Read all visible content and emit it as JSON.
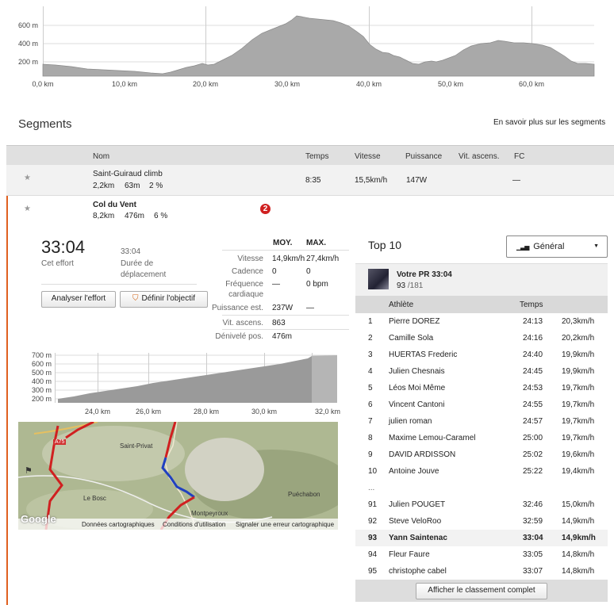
{
  "main_chart": {
    "y_ticks": [
      "600 m",
      "400 m",
      "200 m"
    ],
    "x_ticks": [
      "0,0 km",
      "10,0 km",
      "20,0 km",
      "30,0 km",
      "40,0 km",
      "50,0 km",
      "60,0 km"
    ]
  },
  "segments": {
    "title": "Segments",
    "learn_more": "En savoir plus sur les segments",
    "columns": {
      "name": "Nom",
      "time": "Temps",
      "speed": "Vitesse",
      "power": "Puissance",
      "vam": "Vit. ascens.",
      "hr": "FC"
    },
    "rows": [
      {
        "name": "Saint-Guiraud climb",
        "distance": "2,2km",
        "elevation": "63m",
        "grade": "2 %",
        "time": "8:35",
        "speed": "15,5km/h",
        "power": "147W",
        "hr": "—"
      },
      {
        "name": "Col du Vent",
        "distance": "8,2km",
        "elevation": "476m",
        "grade": "6 %",
        "badge": "2"
      }
    ]
  },
  "effort": {
    "time": "33:04",
    "time_label": "Cet effort",
    "moving_time": "33:04",
    "moving_label": "Durée de déplacement",
    "analyze_button": "Analyser l'effort",
    "goal_button": "Définir l'objectif",
    "stats_head": {
      "avg": "MOY.",
      "max": "MAX."
    },
    "stats": [
      {
        "label": "Vitesse",
        "avg": "14,9km/h",
        "max": "27,4km/h"
      },
      {
        "label": "Cadence",
        "avg": "0",
        "max": "0"
      },
      {
        "label": "Fréquence cardiaque",
        "avg": "—",
        "max": "0 bpm"
      },
      {
        "label": "Puissance est.",
        "avg": "237W",
        "max": "—"
      },
      {
        "label": "Vit. ascens.",
        "avg": "863",
        "max": ""
      },
      {
        "label": "Dénivelé pos.",
        "avg": "476m",
        "max": ""
      }
    ]
  },
  "mini_chart": {
    "y_ticks": [
      "700 m",
      "600 m",
      "500 m",
      "400 m",
      "300 m",
      "200 m"
    ],
    "x_ticks": [
      "24,0 km",
      "26,0 km",
      "28,0 km",
      "30,0 km",
      "32,0 km"
    ]
  },
  "map": {
    "labels": [
      "Saint-Privat",
      "Le Bosc",
      "Puéchabon",
      "Montpeyroux",
      "A75"
    ],
    "footer": [
      "Données cartographiques",
      "Conditions d'utilisation",
      "Signaler une erreur cartographique"
    ],
    "logo": "Google"
  },
  "top10": {
    "title": "Top 10",
    "filter": "Général",
    "pr_label": "Votre PR 33:04",
    "pr_rank": "93",
    "pr_total": "/181",
    "col_athlete": "Athlète",
    "col_time": "Temps",
    "rows": [
      {
        "rank": "1",
        "name": "Pierre DOREZ",
        "time": "24:13",
        "speed": "20,3km/h"
      },
      {
        "rank": "2",
        "name": "Camille Sola",
        "time": "24:16",
        "speed": "20,2km/h"
      },
      {
        "rank": "3",
        "name": "HUERTAS Frederic",
        "time": "24:40",
        "speed": "19,9km/h"
      },
      {
        "rank": "4",
        "name": "Julien Chesnais",
        "time": "24:45",
        "speed": "19,9km/h"
      },
      {
        "rank": "5",
        "name": "Léos Moi Même",
        "time": "24:53",
        "speed": "19,7km/h"
      },
      {
        "rank": "6",
        "name": "Vincent Cantoni",
        "time": "24:55",
        "speed": "19,7km/h"
      },
      {
        "rank": "7",
        "name": "julien roman",
        "time": "24:57",
        "speed": "19,7km/h"
      },
      {
        "rank": "8",
        "name": "Maxime Lemou-Caramel",
        "time": "25:00",
        "speed": "19,7km/h"
      },
      {
        "rank": "9",
        "name": "DAVID ARDISSON",
        "time": "25:02",
        "speed": "19,6km/h"
      },
      {
        "rank": "10",
        "name": "Antoine Jouve",
        "time": "25:22",
        "speed": "19,4km/h"
      }
    ],
    "ellipsis": "...",
    "rows2": [
      {
        "rank": "91",
        "name": "Julien POUGET",
        "time": "32:46",
        "speed": "15,0km/h"
      },
      {
        "rank": "92",
        "name": "Steve VeloRoo",
        "time": "32:59",
        "speed": "14,9km/h"
      },
      {
        "rank": "93",
        "name": "Yann Saintenac",
        "time": "33:04",
        "speed": "14,9km/h"
      },
      {
        "rank": "94",
        "name": "Fleur Faure",
        "time": "33:05",
        "speed": "14,8km/h"
      },
      {
        "rank": "95",
        "name": "christophe cabel",
        "time": "33:07",
        "speed": "14,8km/h"
      }
    ],
    "full_button": "Afficher le classement complet"
  }
}
